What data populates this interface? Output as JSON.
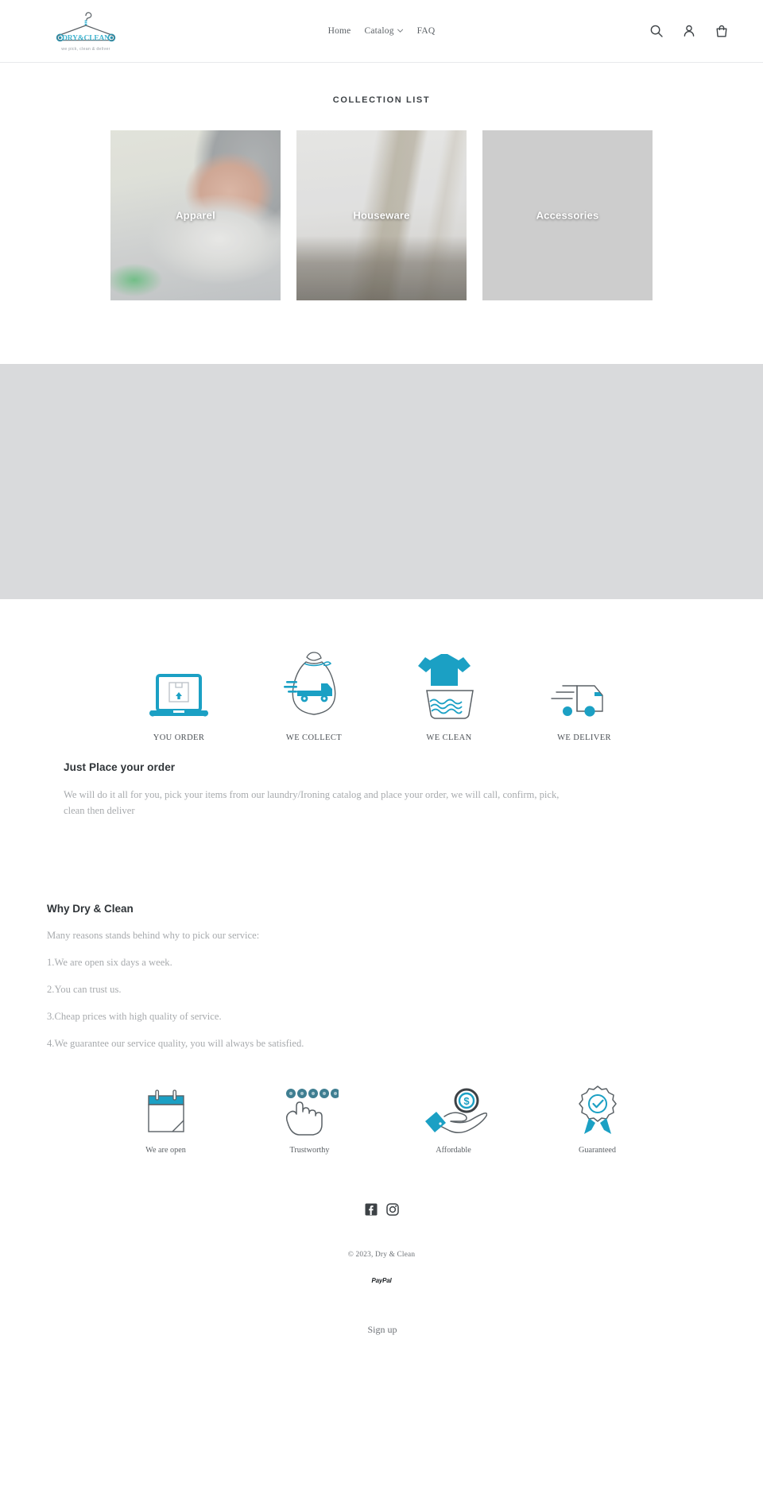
{
  "header": {
    "logo": {
      "brand": "DRY&CLEAN",
      "tagline": "we pick, clean & deliver",
      "icon": "clothes-hanger-icon"
    },
    "nav": [
      {
        "label": "Home",
        "has_dropdown": false
      },
      {
        "label": "Catalog",
        "has_dropdown": true,
        "caret": "⌄"
      },
      {
        "label": "FAQ",
        "has_dropdown": false
      }
    ],
    "icons": [
      {
        "name": "search-icon",
        "label": "Search"
      },
      {
        "name": "account-icon",
        "label": "Log in"
      },
      {
        "name": "cart-icon",
        "label": "Cart"
      }
    ]
  },
  "collection": {
    "title": "COLLECTION LIST",
    "cards": [
      {
        "label": "Apparel",
        "photo": "hand-ironing-shirt-photo"
      },
      {
        "label": "Houseware",
        "photo": "bedroom-interior-photo"
      },
      {
        "label": "Accessories",
        "photo": "straw-hat-on-scarf-photo"
      }
    ]
  },
  "process": {
    "steps": [
      {
        "label": "YOU ORDER",
        "icon": "laptop-order-icon"
      },
      {
        "label": "WE COLLECT",
        "icon": "laundry-bag-truck-icon"
      },
      {
        "label": "WE CLEAN",
        "icon": "shirt-in-washbasin-icon"
      },
      {
        "label": "WE DELIVER",
        "icon": "delivery-truck-icon"
      }
    ]
  },
  "order_block": {
    "heading": "Just Place your order",
    "paragraph": "We will do it all for you, pick your items from our laundry/Ironing catalog and place your order, we will call, confirm, pick, clean then deliver"
  },
  "why_block": {
    "heading": "Why Dry & Clean",
    "intro": "Many reasons stands behind why to pick our service:",
    "reasons": [
      "1.We are open six days a week.",
      "2.You can trust us.",
      "3.Cheap prices with high quality of service.",
      "4.We guarantee our service quality, you will always be satisfied."
    ]
  },
  "badges": [
    {
      "label": "We are open",
      "icon": "calendar-icon"
    },
    {
      "label": "Trustworthy",
      "icon": "hand-five-stars-icon",
      "stars": 5
    },
    {
      "label": "Affordable",
      "icon": "hand-with-dollar-coin-icon"
    },
    {
      "label": "Guaranteed",
      "icon": "award-ribbon-check-icon"
    }
  ],
  "footer": {
    "social": [
      {
        "name": "facebook-icon",
        "label": "Facebook"
      },
      {
        "name": "instagram-icon",
        "label": "Instagram"
      }
    ],
    "copyright": "© 2023, Dry & Clean",
    "payment": "PayPal",
    "signup": "Sign up"
  },
  "colors": {
    "accent": "#1ba0c4",
    "accent_dark": "#13809e",
    "text": "#3d4246",
    "muted": "#a7aaad",
    "band": "#d9dadc",
    "outline": "#5a6166"
  }
}
